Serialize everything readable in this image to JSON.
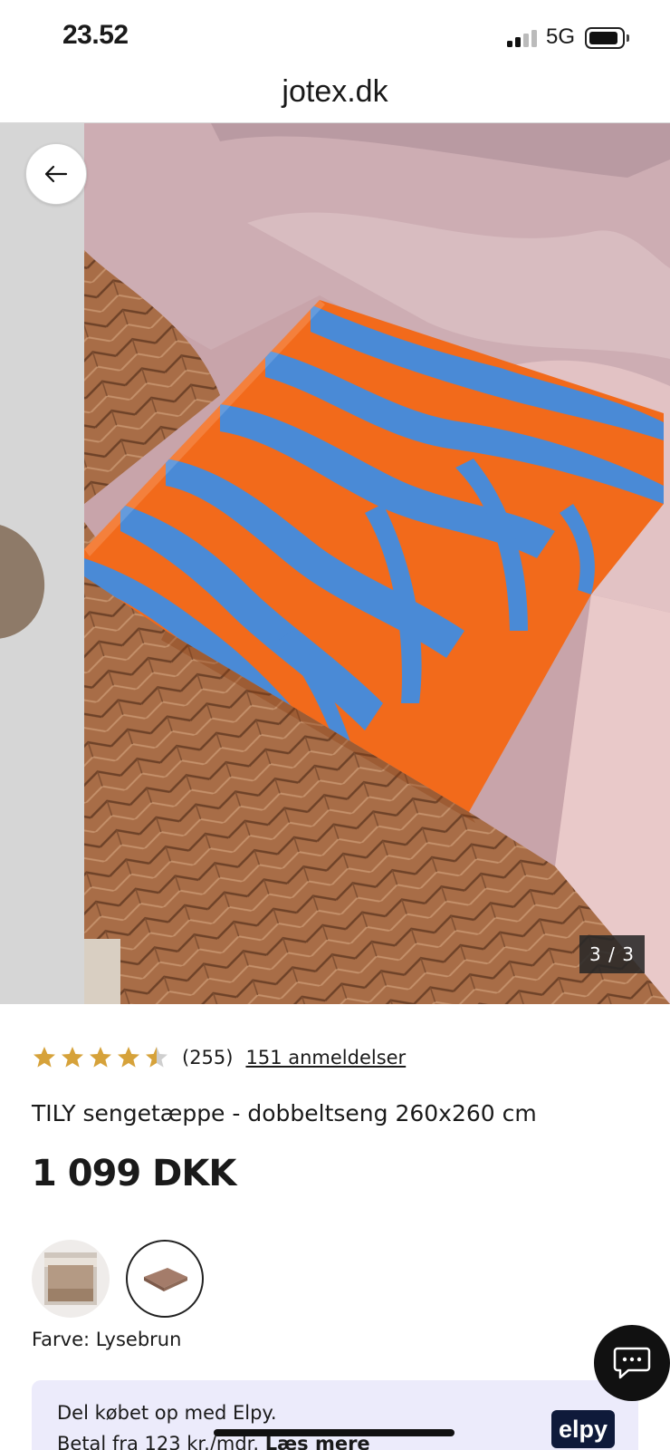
{
  "status_bar": {
    "time": "23.52",
    "network": "5G",
    "battery_level": 0.85
  },
  "browser": {
    "url": "jotex.dk"
  },
  "gallery": {
    "counter": "3 / 3",
    "back_icon": "arrow-left-icon"
  },
  "product": {
    "rating": 4.5,
    "rating_count": "(255)",
    "reviews_link": "151 anmeldelser",
    "title": "TILY sengetæppe - dobbeltseng 260x260 cm",
    "price": "1 099 DKK",
    "color_label": "Farve: Lysebrun"
  },
  "elpy": {
    "line1": "Del købet op med Elpy.",
    "line2_prefix": "Betal fra 123 kr./mdr.",
    "read_more": "Læs mere",
    "logo_text": "elpy"
  },
  "chat": {
    "icon": "chat-icon"
  },
  "colors": {
    "star": "#d6a23a",
    "star_empty": "#cfcfcf",
    "elpy_bg": "#ecebfb",
    "elpy_logo_bg": "#0f1a3a",
    "pillow_orange": "#f26a1b",
    "pillow_blue": "#4a8ad6"
  }
}
